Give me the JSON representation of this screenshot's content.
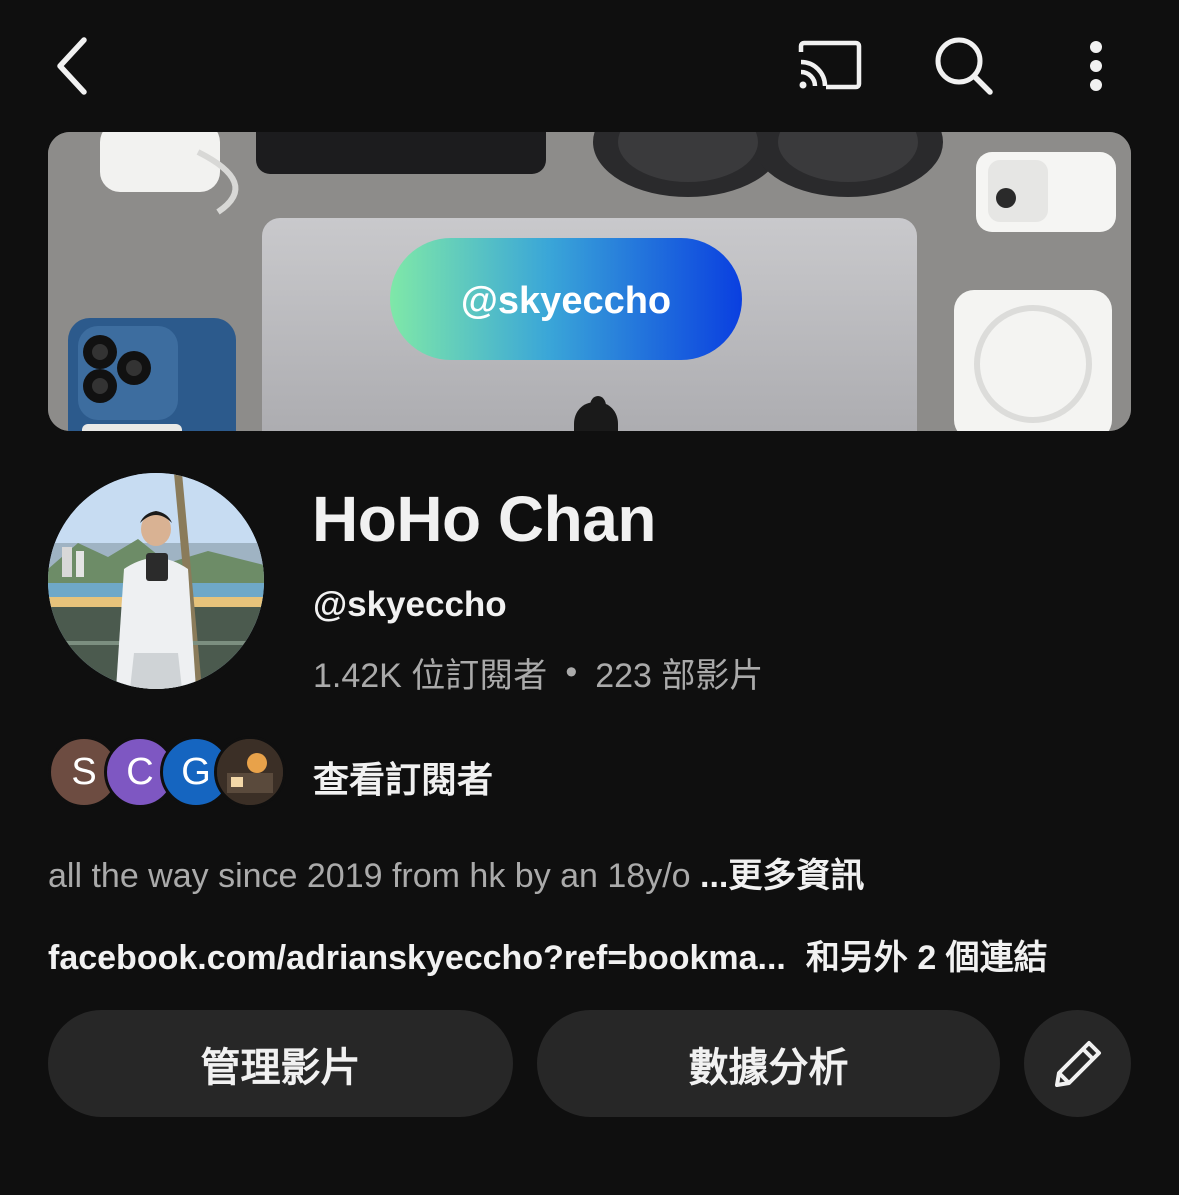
{
  "banner": {
    "pill_text": "@skyeccho"
  },
  "channel": {
    "name": "HoHo Chan",
    "handle": "@skyeccho",
    "subscribers": "1.42K 位訂閱者",
    "separator": "•",
    "videos": "223 部影片"
  },
  "subscribers_preview": {
    "avatars": [
      "S",
      "C",
      "G"
    ],
    "link_label": "查看訂閱者"
  },
  "description": {
    "text": "all the way since 2019 from hk by an 18y/o ",
    "more_label": "...更多資訊"
  },
  "links": {
    "primary": "facebook.com/adrianskyeccho?ref=bookma...",
    "extra": "和另外 2 個連結"
  },
  "actions": {
    "manage_label": "管理影片",
    "analytics_label": "數據分析"
  },
  "icons": {
    "back": "chevron-left-icon",
    "cast": "cast-icon",
    "search": "search-icon",
    "more": "more-vert-icon",
    "edit": "pencil-icon"
  },
  "colors": {
    "background": "#0f0f0f",
    "button_bg": "#272727",
    "text_primary": "#f1f1f1",
    "text_secondary": "#aaaaaa"
  }
}
